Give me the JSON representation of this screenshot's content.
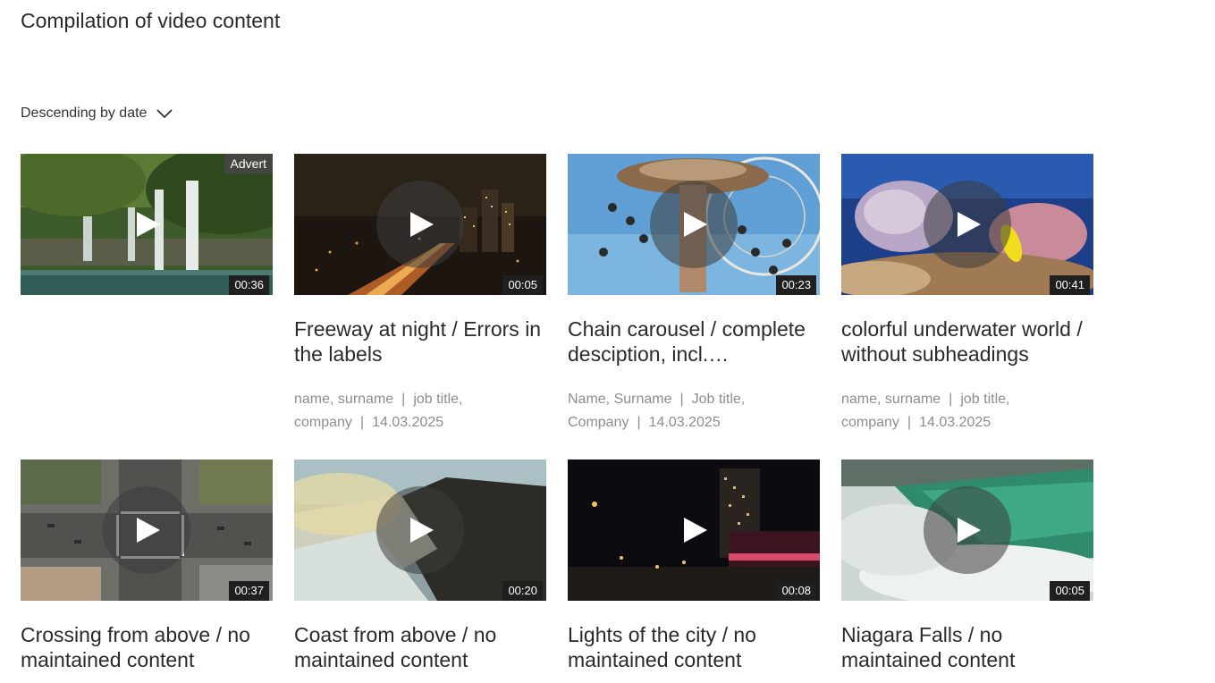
{
  "page": {
    "title": "Compilation of video content",
    "sort_label": "Descending by date"
  },
  "videos": [
    {
      "title": "",
      "duration": "00:36",
      "badge": "Advert",
      "thumb": "waterfall",
      "author": "",
      "job": "",
      "company": "",
      "date": ""
    },
    {
      "title": "Freeway at night / Errors in the labels",
      "duration": "00:05",
      "badge": "",
      "thumb": "night-city",
      "author": "name, surname",
      "job": "job title,",
      "company": "company",
      "date": "14.03.2025"
    },
    {
      "title": "Chain carousel / complete desciption, incl.…",
      "duration": "00:23",
      "badge": "",
      "thumb": "carousel",
      "author": "Name, Surname",
      "job": "Job title,",
      "company": "Company",
      "date": "14.03.2025"
    },
    {
      "title": "colorful underwater world / without subheadings",
      "duration": "00:41",
      "badge": "",
      "thumb": "underwater",
      "author": "name, surname",
      "job": "job title,",
      "company": "company",
      "date": "14.03.2025"
    },
    {
      "title": "Crossing from above / no maintained content",
      "duration": "00:37",
      "badge": "",
      "thumb": "crossing",
      "author": "",
      "job": "",
      "company": "",
      "date": ""
    },
    {
      "title": "Coast from above / no maintained content",
      "duration": "00:20",
      "badge": "",
      "thumb": "coast",
      "author": "",
      "job": "",
      "company": "",
      "date": ""
    },
    {
      "title": "Lights of the city / no maintained content",
      "duration": "00:08",
      "badge": "",
      "thumb": "city-lights",
      "author": "",
      "job": "",
      "company": "",
      "date": ""
    },
    {
      "title": "Niagara Falls / no maintained content",
      "duration": "00:05",
      "badge": "",
      "thumb": "niagara",
      "author": "",
      "job": "",
      "company": "",
      "date": ""
    }
  ],
  "meta_separator": "|"
}
